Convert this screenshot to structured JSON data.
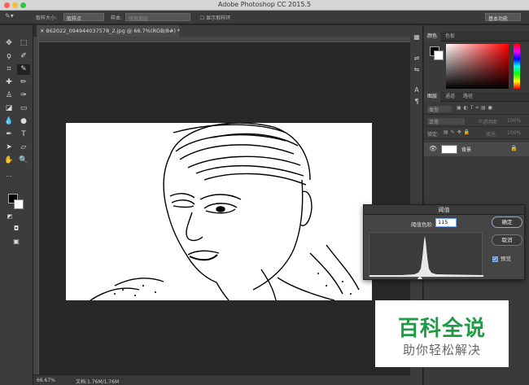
{
  "app": {
    "title": "Adobe Photoshop CC 2015.5"
  },
  "options_bar": {
    "sample_size_label": "取样大小:",
    "sample_size_value": "取样点",
    "sample_label": "样本:",
    "sample_value": "所有图层",
    "show_ring_label": "显示取样环",
    "workspace": "基本功能"
  },
  "document": {
    "tab_label": "862022_094944037578_2.jpg @ 66.7%(RGB/8#) *",
    "zoom": "66.67%",
    "doc_size": "文档:1.76M/1.76M"
  },
  "panels": {
    "color_tabs": [
      "颜色",
      "色板"
    ],
    "layers_tabs": [
      "图层",
      "通道",
      "路径"
    ],
    "filter_kind": "类型",
    "blend_mode": "正常",
    "opacity_label": "不透明度:",
    "opacity_value": "100%",
    "lock_label": "锁定:",
    "fill_label": "填充:",
    "fill_value": "100%",
    "layer_name": "背景"
  },
  "threshold_dialog": {
    "title": "阈值",
    "level_label": "阈值色阶:",
    "level_value": "115",
    "ok": "确定",
    "cancel": "取消",
    "preview_label": "预览",
    "preview_checked": true
  },
  "watermark": {
    "main": "百科全说",
    "sub": "助你轻松解决"
  },
  "colors": {
    "foreground": "#000000",
    "background": "#ffffff",
    "watermark_green": "#1e9c43"
  }
}
